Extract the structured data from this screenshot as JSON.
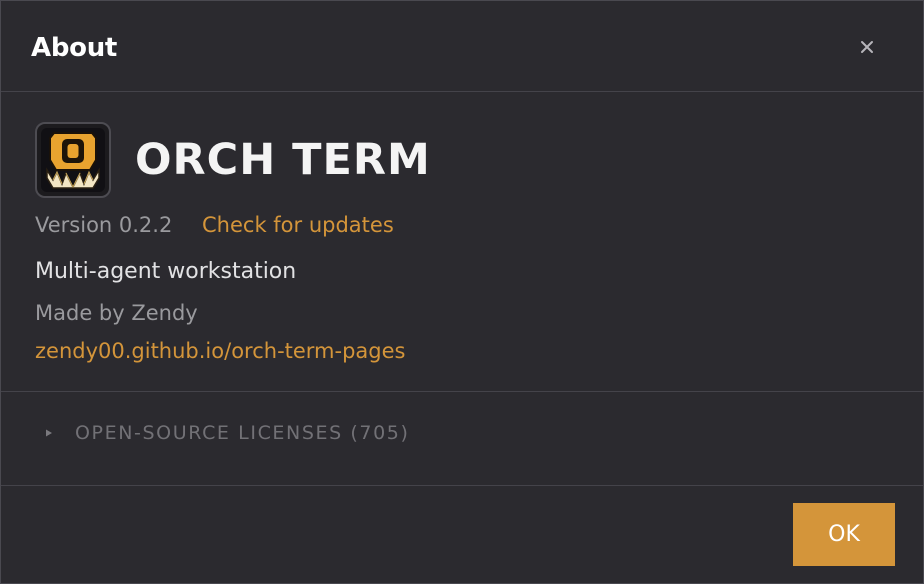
{
  "dialog": {
    "title": "About",
    "close_icon": "close-icon"
  },
  "app": {
    "logo_icon": "orch-term-logo-icon",
    "name": "ORCH TERM",
    "version": "Version 0.2.2",
    "check_updates": "Check for updates",
    "tagline": "Multi-agent workstation",
    "author": "Made by Zendy",
    "website": "zendy00.github.io/orch-term-pages"
  },
  "licenses": {
    "toggle_icon": "caret-right-icon",
    "label": "OPEN-SOURCE LICENSES (705)"
  },
  "footer": {
    "ok_label": "OK"
  },
  "colors": {
    "background": "#2b2a2f",
    "accent": "#d4953a",
    "text_primary": "#ffffff",
    "text_muted": "#9a9a9e",
    "divider": "#44434a"
  }
}
